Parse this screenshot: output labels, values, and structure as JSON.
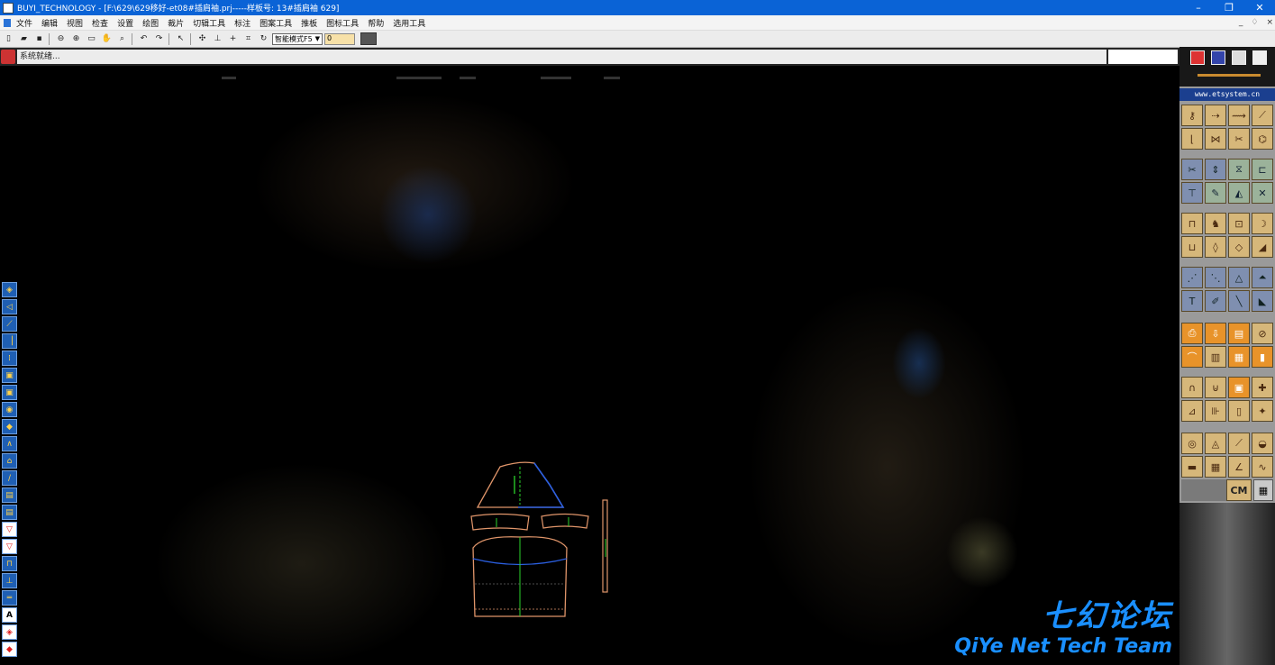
{
  "window": {
    "title": "BUYI_TECHNOLOGY - [F:\\629\\629移好-et08#插肩袖.prj-----样板号: 13#插肩袖 629]",
    "controls": [
      "–",
      "❐",
      "✕"
    ]
  },
  "menubar": {
    "items": [
      "文件",
      "编辑",
      "视图",
      "检查",
      "设置",
      "绘图",
      "裁片",
      "切辑工具",
      "标注",
      "图案工具",
      "推板",
      "图标工具",
      "帮助",
      "选用工具"
    ],
    "mdi_controls": [
      "_",
      "♢",
      "×"
    ]
  },
  "toolbar": {
    "mode_select": "智能模式F5",
    "number_value": "0"
  },
  "status": {
    "text": "系统就绪..."
  },
  "sidebar": {
    "website": "www.etsystem.cn",
    "unit_label": "CM"
  },
  "left_tools": [
    "◈",
    "◁",
    "⟋",
    "▕",
    "⁞",
    "▣",
    "▣",
    "◉",
    "◆",
    "∧",
    "⌂",
    "∕",
    "▤",
    "▤",
    "▽",
    "▽",
    "⊓",
    "⊥",
    "═",
    "A",
    "◈",
    "◆"
  ],
  "watermark": {
    "cn": "七幻论坛",
    "en": "QiYe Net Tech Team"
  },
  "colors": {
    "titlebar": "#0a63d6",
    "pattern_outline": "#e0956a",
    "pattern_grain": "#2bd42b",
    "pattern_blue": "#2b5fe0",
    "watermark": "#1a8fff"
  }
}
